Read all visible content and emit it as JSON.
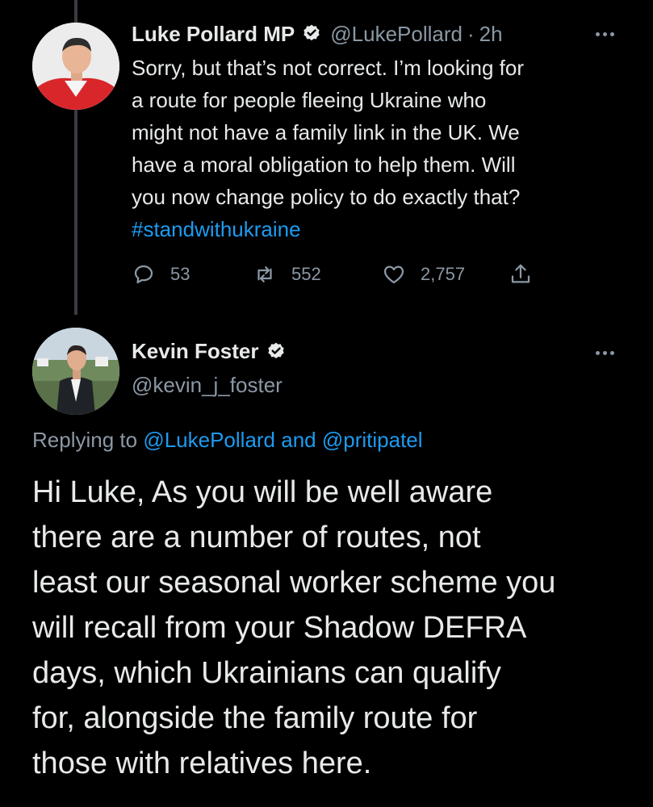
{
  "tweet1": {
    "author_name": "Luke Pollard MP",
    "handle": "@LukePollard",
    "separator": "·",
    "time": "2h",
    "lines": [
      "Sorry, but that’s not correct. I’m looking for",
      "a route for people fleeing Ukraine who",
      "might not have a family link in the UK. We",
      "have a moral obligation to help them. Will",
      "you now change policy to do exactly that?"
    ],
    "hashtag": "#standwithukraine",
    "reply_count": "53",
    "retweet_count": "552",
    "like_count": "2,757"
  },
  "tweet2": {
    "author_name": "Kevin Foster",
    "handle": "@kevin_j_foster",
    "replying_prefix": "Replying to ",
    "replying_user1": "@LukePollard",
    "replying_and": " and ",
    "replying_user2": "@pritipatel",
    "lines": [
      "Hi Luke, As you will be well aware",
      "there are a number of routes, not",
      "least our seasonal worker scheme you",
      "will recall from your Shadow DEFRA",
      "days, which Ukrainians can qualify",
      "for, alongside the family route for",
      "those with relatives here."
    ]
  },
  "colors": {
    "background": "#000000",
    "text": "#e7e9ea",
    "secondary": "#8b98a5",
    "accent": "#1d9bf0",
    "thread_line": "#3a3d41"
  },
  "icons": {
    "verified": "verified-badge-icon",
    "more": "more-options-icon",
    "reply": "reply-icon",
    "retweet": "retweet-icon",
    "like": "heart-icon",
    "share": "share-icon"
  }
}
